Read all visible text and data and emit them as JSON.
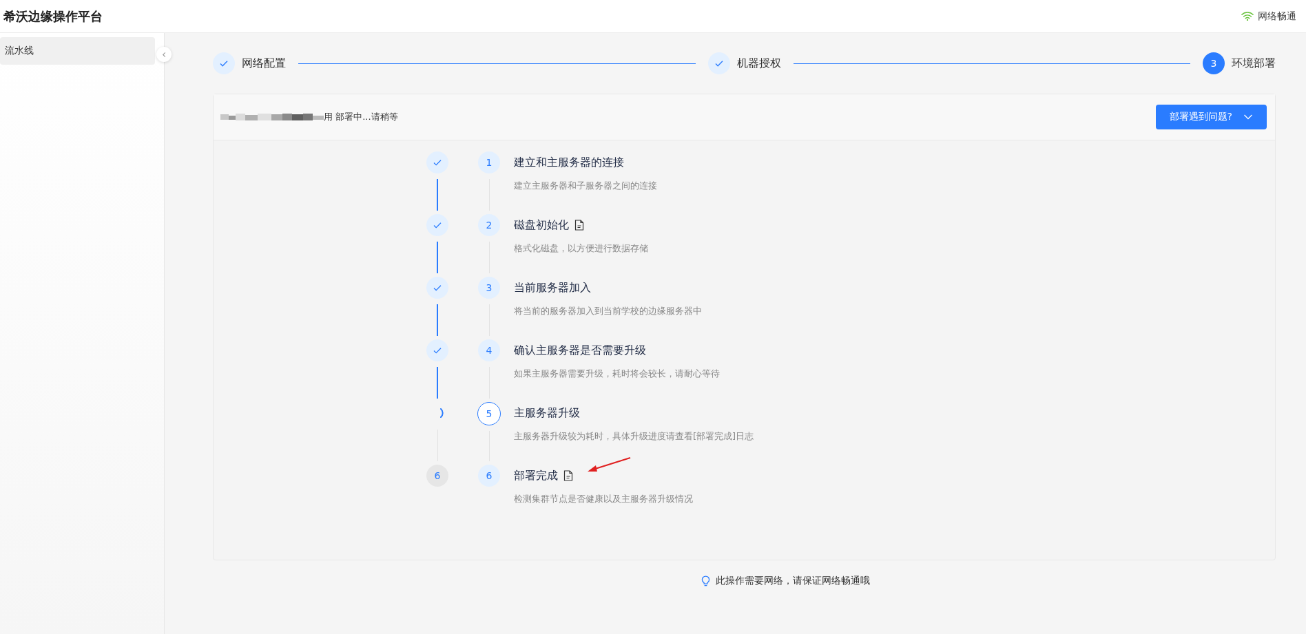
{
  "header": {
    "title": "希沃边缘操作平台",
    "network_status": "网络畅通"
  },
  "sidebar": {
    "items": [
      {
        "label": "流水线",
        "selected": true
      }
    ]
  },
  "stepper": [
    {
      "label": "网络配置",
      "kind": "done"
    },
    {
      "label": "机器授权",
      "kind": "done"
    },
    {
      "label": "环境部署",
      "kind": "active",
      "number": "3"
    }
  ],
  "card": {
    "status_text": "用 部署中...请稍等",
    "redacted": true,
    "help_button": "部署遇到问题?",
    "steps": [
      {
        "number": "1",
        "title": "建立和主服务器的连接",
        "description": "建立主服务器和子服务器之间的连接",
        "kind": "done",
        "has_log": false,
        "marked": false
      },
      {
        "number": "2",
        "title": "磁盘初始化",
        "description": "格式化磁盘，以方便进行数据存储",
        "kind": "done",
        "has_log": true,
        "marked": false
      },
      {
        "number": "3",
        "title": "当前服务器加入",
        "description": "将当前的服务器加入到当前学校的边缘服务器中",
        "kind": "done",
        "has_log": false,
        "marked": false
      },
      {
        "number": "4",
        "title": "确认主服务器是否需要升级",
        "description": "如果主服务器需要升级，耗时将会较长，请耐心等待",
        "kind": "done",
        "has_log": false,
        "marked": false
      },
      {
        "number": "5",
        "title": "主服务器升级",
        "description": "主服务器升级较为耗时，具体升级进度请查看[部署完成]日志",
        "kind": "running",
        "has_log": false,
        "marked": false
      },
      {
        "number": "6",
        "title": "部署完成",
        "description": "检测集群节点是否健康以及主服务器升级情况",
        "kind": "pending",
        "status_number": "6",
        "has_log": true,
        "marked": true
      }
    ]
  },
  "footer_hint": "此操作需要网络，请保证网络畅通哦"
}
